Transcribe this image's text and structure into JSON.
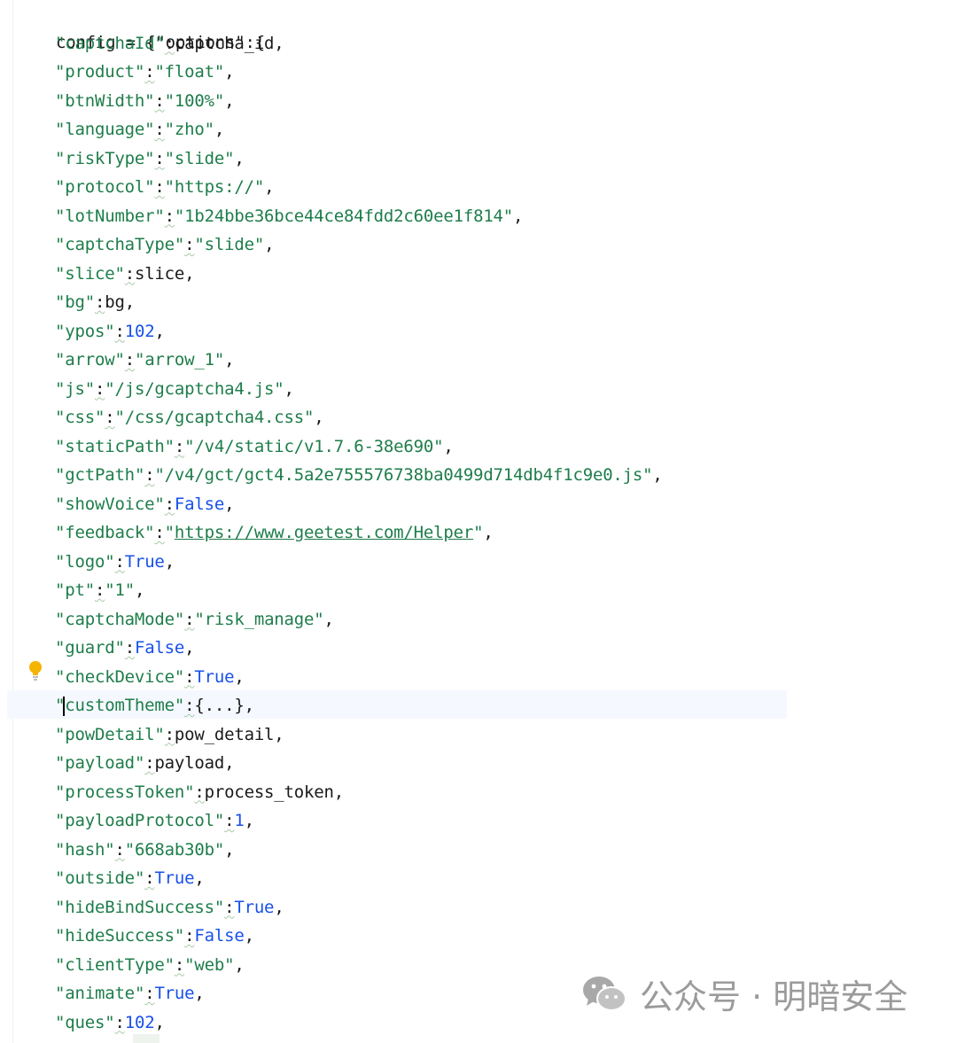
{
  "editor": {
    "header": "config = {\"options\":{",
    "lines": [
      {
        "key": "captchaId",
        "sep": ":",
        "value": "captcha_id",
        "kind": "var",
        "tail": ","
      },
      {
        "key": "product",
        "sep": ":",
        "value": "\"float\"",
        "kind": "str",
        "tail": ","
      },
      {
        "key": "btnWidth",
        "sep": ":",
        "value": "\"100%\"",
        "kind": "str",
        "tail": ","
      },
      {
        "key": "language",
        "sep": ":",
        "value": "\"zho\"",
        "kind": "str",
        "tail": ","
      },
      {
        "key": "riskType",
        "sep": ":",
        "value": "\"slide\"",
        "kind": "str",
        "tail": ","
      },
      {
        "key": "protocol",
        "sep": ":",
        "value": "\"https://\"",
        "kind": "str",
        "tail": ","
      },
      {
        "key": "lotNumber",
        "sep": ":",
        "value": "\"1b24bbe36bce44ce84fdd2c60ee1f814\"",
        "kind": "str",
        "tail": ","
      },
      {
        "key": "captchaType",
        "sep": ":",
        "value": "\"slide\"",
        "kind": "str",
        "tail": ","
      },
      {
        "key": "slice",
        "sep": ":",
        "value": "slice",
        "kind": "var",
        "tail": ","
      },
      {
        "key": "bg",
        "sep": ":",
        "value": "bg",
        "kind": "var",
        "tail": ","
      },
      {
        "key": "ypos",
        "sep": ":",
        "value": "102",
        "kind": "num",
        "tail": ","
      },
      {
        "key": "arrow",
        "sep": ":",
        "value": "\"arrow_1\"",
        "kind": "str",
        "tail": ","
      },
      {
        "key": "js",
        "sep": ":",
        "value": "\"/js/gcaptcha4.js\"",
        "kind": "str",
        "tail": ","
      },
      {
        "key": "css",
        "sep": ":",
        "value": "\"/css/gcaptcha4.css\"",
        "kind": "str",
        "tail": ","
      },
      {
        "key": "staticPath",
        "sep": ":",
        "value": "\"/v4/static/v1.7.6-38e690\"",
        "kind": "str",
        "tail": ","
      },
      {
        "key": "gctPath",
        "sep": ":",
        "value": "\"/v4/gct/gct4.5a2e755576738ba0499d714db4f1c9e0.js\"",
        "kind": "str",
        "tail": ","
      },
      {
        "key": "showVoice",
        "sep": ":",
        "value": "False",
        "kind": "kw",
        "tail": ","
      },
      {
        "key": "feedback",
        "sep": ":",
        "value": "https://www.geetest.com/Helper",
        "kind": "url",
        "tail": ","
      },
      {
        "key": "logo",
        "sep": ":",
        "value": "True",
        "kind": "kw",
        "tail": ","
      },
      {
        "key": "pt",
        "sep": ":",
        "value": "\"1\"",
        "kind": "str",
        "tail": ","
      },
      {
        "key": "captchaMode",
        "sep": ":",
        "value": "\"risk_manage\"",
        "kind": "str",
        "tail": ","
      },
      {
        "key": "guard",
        "sep": ":",
        "value": "False",
        "kind": "kw",
        "tail": ","
      },
      {
        "key": "checkDevice",
        "sep": ":",
        "value": "True",
        "kind": "kw",
        "tail": ","
      },
      {
        "key": "customTheme",
        "sep": ":",
        "value": "{...}",
        "kind": "var",
        "tail": ",",
        "current": true
      },
      {
        "key": "powDetail",
        "sep": ":",
        "value": "pow_detail",
        "kind": "var",
        "tail": ","
      },
      {
        "key": "payload",
        "sep": ":",
        "value": "payload",
        "kind": "var",
        "tail": ","
      },
      {
        "key": "processToken",
        "sep": ":",
        "value": "process_token",
        "kind": "var",
        "tail": ","
      },
      {
        "key": "payloadProtocol",
        "sep": ":",
        "value": "1",
        "kind": "num",
        "tail": ","
      },
      {
        "key": "hash",
        "sep": ":",
        "value": "\"668ab30b\"",
        "kind": "str",
        "tail": ","
      },
      {
        "key": "outside",
        "sep": ":",
        "value": "True",
        "kind": "kw",
        "tail": ","
      },
      {
        "key": "hideBindSuccess",
        "sep": ":",
        "value": "True",
        "kind": "kw",
        "tail": ","
      },
      {
        "key": "hideSuccess",
        "sep": ":",
        "value": "False",
        "kind": "kw",
        "tail": ","
      },
      {
        "key": "clientType",
        "sep": ":",
        "value": "\"web\"",
        "kind": "str",
        "tail": ","
      },
      {
        "key": "animate",
        "sep": ":",
        "value": "True",
        "kind": "kw",
        "tail": ","
      },
      {
        "key": "ques",
        "sep": ":",
        "value": "102",
        "kind": "num",
        "tail": ","
      }
    ]
  },
  "gutter": {
    "intention_icon": "lightbulb-icon"
  },
  "watermark": {
    "icon": "wechat-icon",
    "text": "公众号 · 明暗安全"
  },
  "colors": {
    "string": "#1e7d4a",
    "keyword": "#1750eb",
    "text": "#1a1a1a",
    "current_line": "#f5f8fe"
  }
}
